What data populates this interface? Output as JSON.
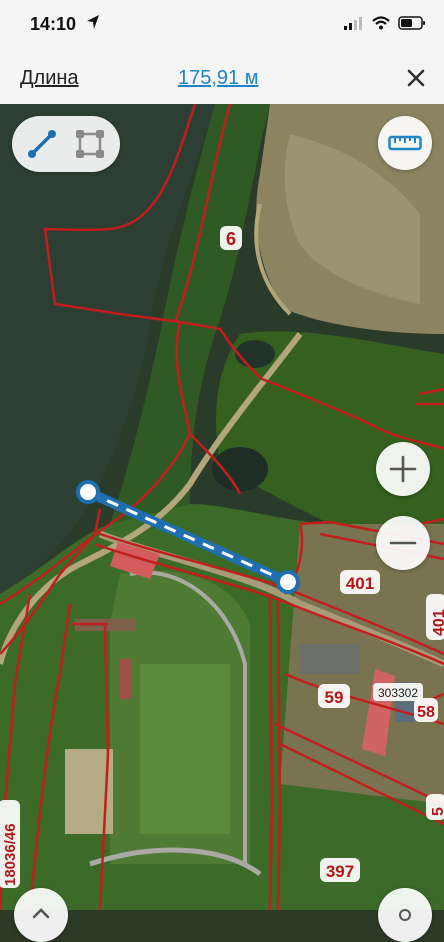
{
  "status_bar": {
    "time": "14:10"
  },
  "measure_bar": {
    "label": "Длина",
    "value": "175,91 м"
  },
  "map": {
    "parcel_labels": [
      "6",
      "401",
      "59",
      "303302",
      "58",
      "397",
      "18036/46",
      "401",
      "5"
    ],
    "colors": {
      "parcel_border": "#c21e1e",
      "measure_line": "#1f6fb0",
      "label_text": "#b01818",
      "accent": "#1f84c4"
    }
  },
  "controls": {
    "line_tool": "line-measure-icon",
    "area_tool": "area-measure-icon",
    "ruler": "ruler-icon",
    "zoom_in": "plus-icon",
    "zoom_out": "minus-icon"
  }
}
